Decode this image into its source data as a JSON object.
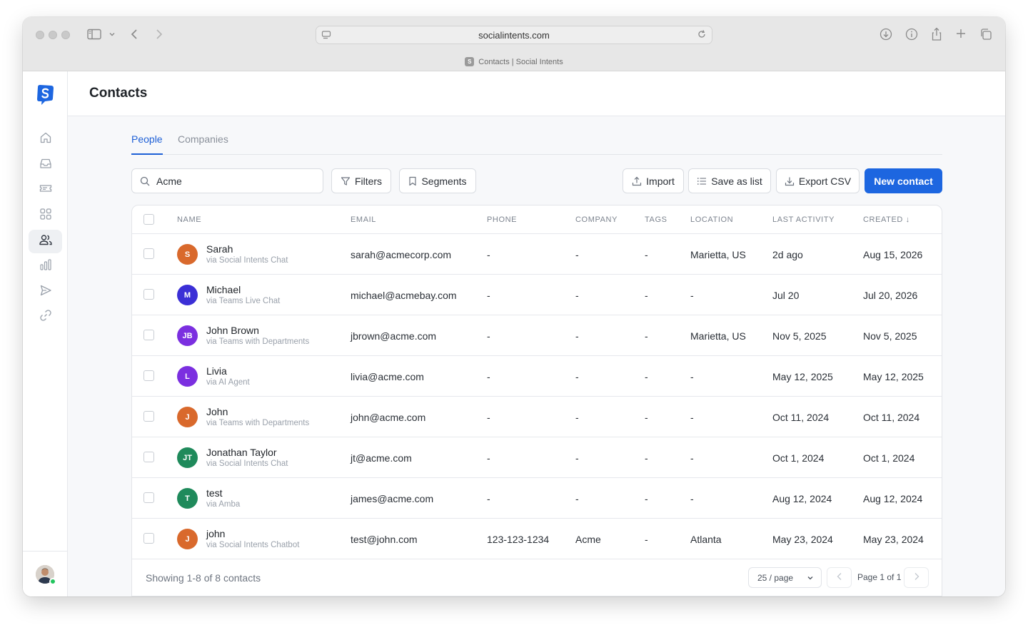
{
  "browser": {
    "url": "socialintents.com",
    "tab_title": "Contacts | Social Intents",
    "tab_favicon": "S"
  },
  "page": {
    "title": "Contacts"
  },
  "sidebar": {
    "items": [
      {
        "icon": "home-icon"
      },
      {
        "icon": "inbox-icon"
      },
      {
        "icon": "ticket-icon"
      },
      {
        "icon": "apps-grid-icon"
      },
      {
        "icon": "contacts-icon",
        "active": true
      },
      {
        "icon": "reports-chart-icon"
      },
      {
        "icon": "send-icon"
      },
      {
        "icon": "link-icon"
      }
    ]
  },
  "tabs": [
    {
      "label": "People",
      "active": true
    },
    {
      "label": "Companies",
      "active": false
    }
  ],
  "toolbar": {
    "search_value": "Acme",
    "filters_label": "Filters",
    "segments_label": "Segments",
    "import_label": "Import",
    "save_list_label": "Save as list",
    "export_label": "Export CSV",
    "new_contact_label": "New contact"
  },
  "table": {
    "headers": [
      "NAME",
      "EMAIL",
      "PHONE",
      "COMPANY",
      "TAGS",
      "LOCATION",
      "LAST ACTIVITY",
      "CREATED ↓"
    ],
    "rows": [
      {
        "initials": "S",
        "color": "#d9692c",
        "name": "Sarah",
        "via": "via Social Intents Chat",
        "email": "sarah@acmecorp.com",
        "phone": "-",
        "company": "-",
        "tags": "-",
        "location": "Marietta, US",
        "last": "2d ago",
        "created": "Aug 15, 2026"
      },
      {
        "initials": "M",
        "color": "#3b2fd6",
        "name": "Michael",
        "via": "via Teams Live Chat",
        "email": "michael@acmebay.com",
        "phone": "-",
        "company": "-",
        "tags": "-",
        "location": "-",
        "last": "Jul 20",
        "created": "Jul 20, 2026"
      },
      {
        "initials": "JB",
        "color": "#7b2fe0",
        "name": "John Brown",
        "via": "via Teams with Departments",
        "email": "jbrown@acme.com",
        "phone": "-",
        "company": "-",
        "tags": "-",
        "location": "Marietta, US",
        "last": "Nov 5, 2025",
        "created": "Nov 5, 2025"
      },
      {
        "initials": "L",
        "color": "#7b2fe0",
        "name": "Livia",
        "via": "via AI Agent",
        "email": "livia@acme.com",
        "phone": "-",
        "company": "-",
        "tags": "-",
        "location": "-",
        "last": "May 12, 2025",
        "created": "May 12, 2025"
      },
      {
        "initials": "J",
        "color": "#d9692c",
        "name": "John",
        "via": "via Teams with Departments",
        "email": "john@acme.com",
        "phone": "-",
        "company": "-",
        "tags": "-",
        "location": "-",
        "last": "Oct 11, 2024",
        "created": "Oct 11, 2024"
      },
      {
        "initials": "JT",
        "color": "#1f8a5b",
        "name": "Jonathan Taylor",
        "via": "via Social Intents Chat",
        "email": "jt@acme.com",
        "phone": "-",
        "company": "-",
        "tags": "-",
        "location": "-",
        "last": "Oct 1, 2024",
        "created": "Oct 1, 2024"
      },
      {
        "initials": "T",
        "color": "#1f8a5b",
        "name": "test",
        "via": "via Amba",
        "email": "james@acme.com",
        "phone": "-",
        "company": "-",
        "tags": "-",
        "location": "-",
        "last": "Aug 12, 2024",
        "created": "Aug 12, 2024"
      },
      {
        "initials": "J",
        "color": "#d9692c",
        "name": "john",
        "via": "via Social Intents Chatbot",
        "email": "test@john.com",
        "phone": "123-123-1234",
        "company": "Acme",
        "tags": "-",
        "location": "Atlanta",
        "last": "May 23, 2024",
        "created": "May 23, 2024"
      }
    ]
  },
  "footer": {
    "showing": "Showing 1-8 of 8 contacts",
    "per_page": "25 / page",
    "page_label": "Page 1 of 1"
  },
  "colors": {
    "accent": "#1d66e0",
    "active_tab": "#1d5fd6",
    "online": "#22c55e"
  }
}
